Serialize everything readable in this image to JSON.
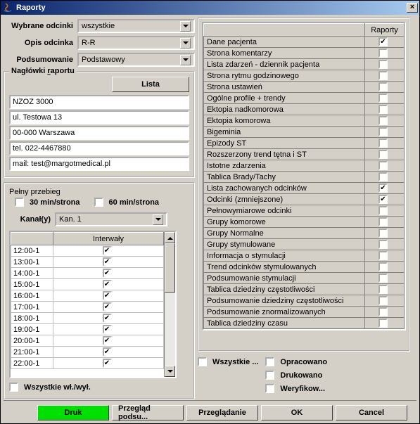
{
  "window": {
    "title": "Raporty"
  },
  "left": {
    "selectors": {
      "wybrane_label": "Wybrane odcinki",
      "wybrane_value": "wszystkie",
      "opis_label": "Opis odcinka",
      "opis_value": "R-R",
      "pods_label": "Podsumowanie",
      "pods_value": "Podstawowy"
    },
    "naglowki": {
      "legend": "Nagłówki raportu",
      "button": "Lista",
      "fields": [
        "NZOZ 3000",
        "ul. Testowa 13",
        "00-000 Warszawa",
        "tel. 022-4467880",
        "mail: test@margotmedical.pl"
      ]
    },
    "pelny": {
      "legend": "Pełny przebieg",
      "opt30": "30 min/strona",
      "opt60": "60 min/strona",
      "kanal_label": "Kanał(y)",
      "kanal_value": "Kan. 1",
      "interwaly_header": "Interwały",
      "rows": [
        {
          "t": "12:00-1",
          "c": true
        },
        {
          "t": "13:00-1",
          "c": true
        },
        {
          "t": "14:00-1",
          "c": true
        },
        {
          "t": "15:00-1",
          "c": true
        },
        {
          "t": "16:00-1",
          "c": true
        },
        {
          "t": "17:00-1",
          "c": true
        },
        {
          "t": "18:00-1",
          "c": true
        },
        {
          "t": "19:00-1",
          "c": true
        },
        {
          "t": "20:00-1",
          "c": true
        },
        {
          "t": "21:00-1",
          "c": true
        },
        {
          "t": "22:00-1",
          "c": true
        }
      ],
      "wszystkie": "Wszystkie wł./wył."
    }
  },
  "right": {
    "col_header": "Raporty",
    "items": [
      {
        "name": "Dane pacjenta",
        "c": true
      },
      {
        "name": "Strona komentarzy",
        "c": false
      },
      {
        "name": "Lista zdarzeń - dziennik pacjenta",
        "c": false
      },
      {
        "name": "Strona rytmu godzinowego",
        "c": false
      },
      {
        "name": "Strona ustawień",
        "c": false
      },
      {
        "name": "Ogólne profile + trendy",
        "c": false
      },
      {
        "name": "Ektopia nadkomorowa",
        "c": false
      },
      {
        "name": "Ektopia komorowa",
        "c": false
      },
      {
        "name": "Bigeminia",
        "c": false
      },
      {
        "name": "Epizody ST",
        "c": false
      },
      {
        "name": "Rozszerzony trend tętna i ST",
        "c": false
      },
      {
        "name": "Istotne zdarzenia",
        "c": false
      },
      {
        "name": "Tablica Brady/Tachy",
        "c": false
      },
      {
        "name": "Lista zachowanych odcinków",
        "c": true
      },
      {
        "name": "Odcinki (zmniejszone)",
        "c": true
      },
      {
        "name": "Pełnowymiarowe odcinki",
        "c": false
      },
      {
        "name": "Grupy komorowe",
        "c": false
      },
      {
        "name": "Grupy Normalne",
        "c": false
      },
      {
        "name": "Grupy stymulowane",
        "c": false
      },
      {
        "name": "Informacja o stymulacji",
        "c": false
      },
      {
        "name": "Trend odcinków stymulowanych",
        "c": false
      },
      {
        "name": "Podsumowanie stymulacji",
        "c": false
      },
      {
        "name": "Tablica dziedziny częstotliwości",
        "c": false
      },
      {
        "name": "Podsumowanie dziedziny częstotliwości",
        "c": false
      },
      {
        "name": "Podsumowanie znormalizowanych",
        "c": false
      },
      {
        "name": "Tablica dziedziny czasu",
        "c": false
      }
    ],
    "filters": {
      "wszystkie": "Wszystkie ...",
      "opracowano": "Opracowano",
      "drukowano": "Drukowano",
      "weryfikow": "Weryfikow..."
    }
  },
  "buttons": {
    "druk": "Druk",
    "przeglad": "Przegląd podsu...",
    "przegladanie": "Przeglądanie",
    "ok": "OK",
    "cancel": "Cancel"
  }
}
